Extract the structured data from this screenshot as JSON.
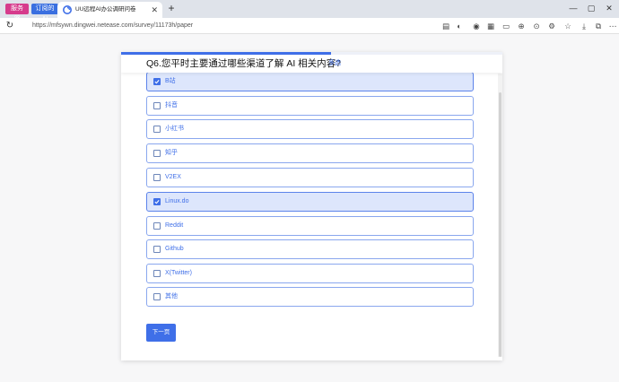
{
  "browser": {
    "pinned_tabs": [
      "服务器",
      "订阅的AI"
    ],
    "tab_title": "UU远程AI办公调研问卷",
    "url": "https://mfsywn.dingwei.netease.com/survey/11173h/paper"
  },
  "survey": {
    "progress_percent": 55,
    "question": "Q6.您平时主要通过哪些渠道了解 AI 相关内容?",
    "question_type": "多选",
    "options": [
      {
        "label": "B站",
        "checked": true
      },
      {
        "label": "抖音",
        "checked": false
      },
      {
        "label": "小红书",
        "checked": false
      },
      {
        "label": "知乎",
        "checked": false
      },
      {
        "label": "V2EX",
        "checked": false
      },
      {
        "label": "Linux.do",
        "checked": true
      },
      {
        "label": "Reddit",
        "checked": false
      },
      {
        "label": "Github",
        "checked": false
      },
      {
        "label": "X(Twitter)",
        "checked": false
      },
      {
        "label": "其他",
        "checked": false
      }
    ],
    "next_label": "下一页"
  },
  "colors": {
    "accent": "#3f6fe8",
    "checked_bg": "#dde6fc"
  }
}
